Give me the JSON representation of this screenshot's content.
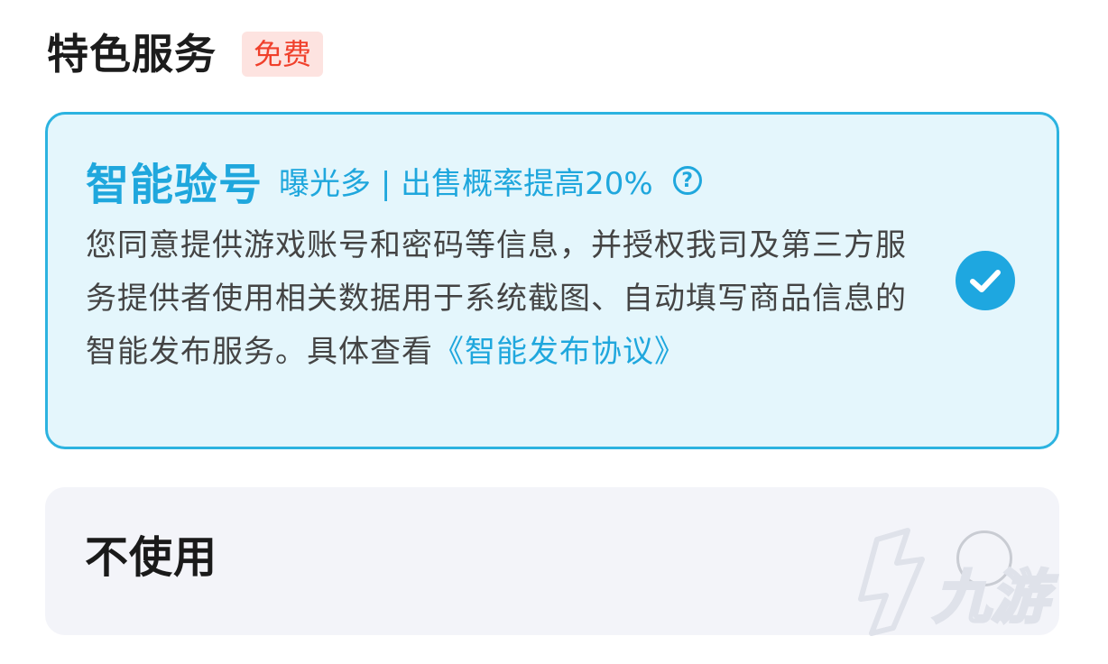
{
  "section": {
    "title": "特色服务",
    "badge": "免费"
  },
  "option_smart": {
    "title": "智能验号",
    "tagline": "曝光多 | 出售概率提高20%",
    "help_glyph": "?",
    "description": "您同意提供游戏账号和密码等信息，并授权我司及第三方服务提供者使用相关数据用于系统截图、自动填写商品信息的智能发布服务。具体查看",
    "agreement_link": "《智能发布协议》",
    "selected": true
  },
  "option_none": {
    "label": "不使用",
    "selected": false
  },
  "colors": {
    "accent": "#1fa7dd",
    "badge_bg": "#fde3e0",
    "badge_text": "#f0402b",
    "selected_bg": "#e4f6fc",
    "unselected_bg": "#f3f4f9"
  },
  "watermark": {
    "text": "九游"
  }
}
